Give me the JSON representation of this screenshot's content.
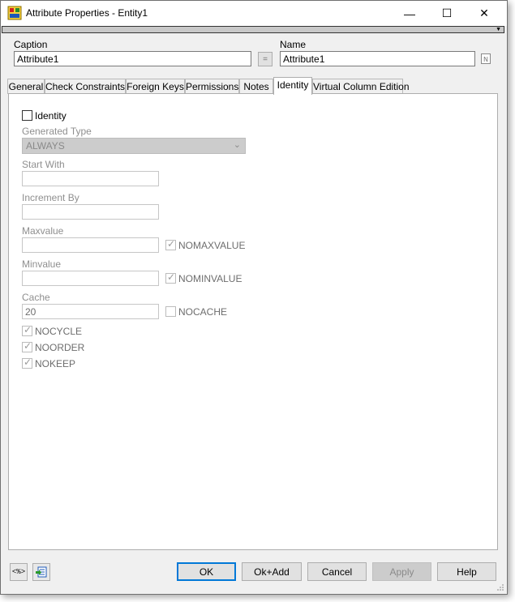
{
  "window": {
    "title": "Attribute Properties - Entity1",
    "minimize": "—",
    "maximize": "☐",
    "close": "✕"
  },
  "toolbar": {
    "arrow": "▼"
  },
  "caption": {
    "label": "Caption",
    "value": "Attribute1"
  },
  "equals_button": "=",
  "name": {
    "label": "Name",
    "value": "Attribute1"
  },
  "tabs": [
    {
      "label": "General"
    },
    {
      "label": "Check Constraints"
    },
    {
      "label": "Foreign Keys"
    },
    {
      "label": "Permissions"
    },
    {
      "label": "Notes"
    },
    {
      "label": "Identity"
    },
    {
      "label": "Virtual Column Edition"
    }
  ],
  "identity": {
    "identity_label": "Identity",
    "generated_type_label": "Generated Type",
    "generated_type_value": "ALWAYS",
    "start_with_label": "Start With",
    "start_with_value": "",
    "increment_by_label": "Increment By",
    "increment_by_value": "",
    "maxvalue_label": "Maxvalue",
    "maxvalue_value": "",
    "nomaxvalue_label": "NOMAXVALUE",
    "minvalue_label": "Minvalue",
    "minvalue_value": "",
    "nominvalue_label": "NOMINVALUE",
    "cache_label": "Cache",
    "cache_value": "20",
    "nocache_label": "NOCACHE",
    "nocycle_label": "NOCYCLE",
    "noorder_label": "NOORDER",
    "nokeep_label": "NOKEEP",
    "check_mark": "✓"
  },
  "footer": {
    "script_icon_text": "<%>",
    "ok": "OK",
    "ok_add": "Ok+Add",
    "cancel": "Cancel",
    "apply": "Apply",
    "help": "Help"
  }
}
